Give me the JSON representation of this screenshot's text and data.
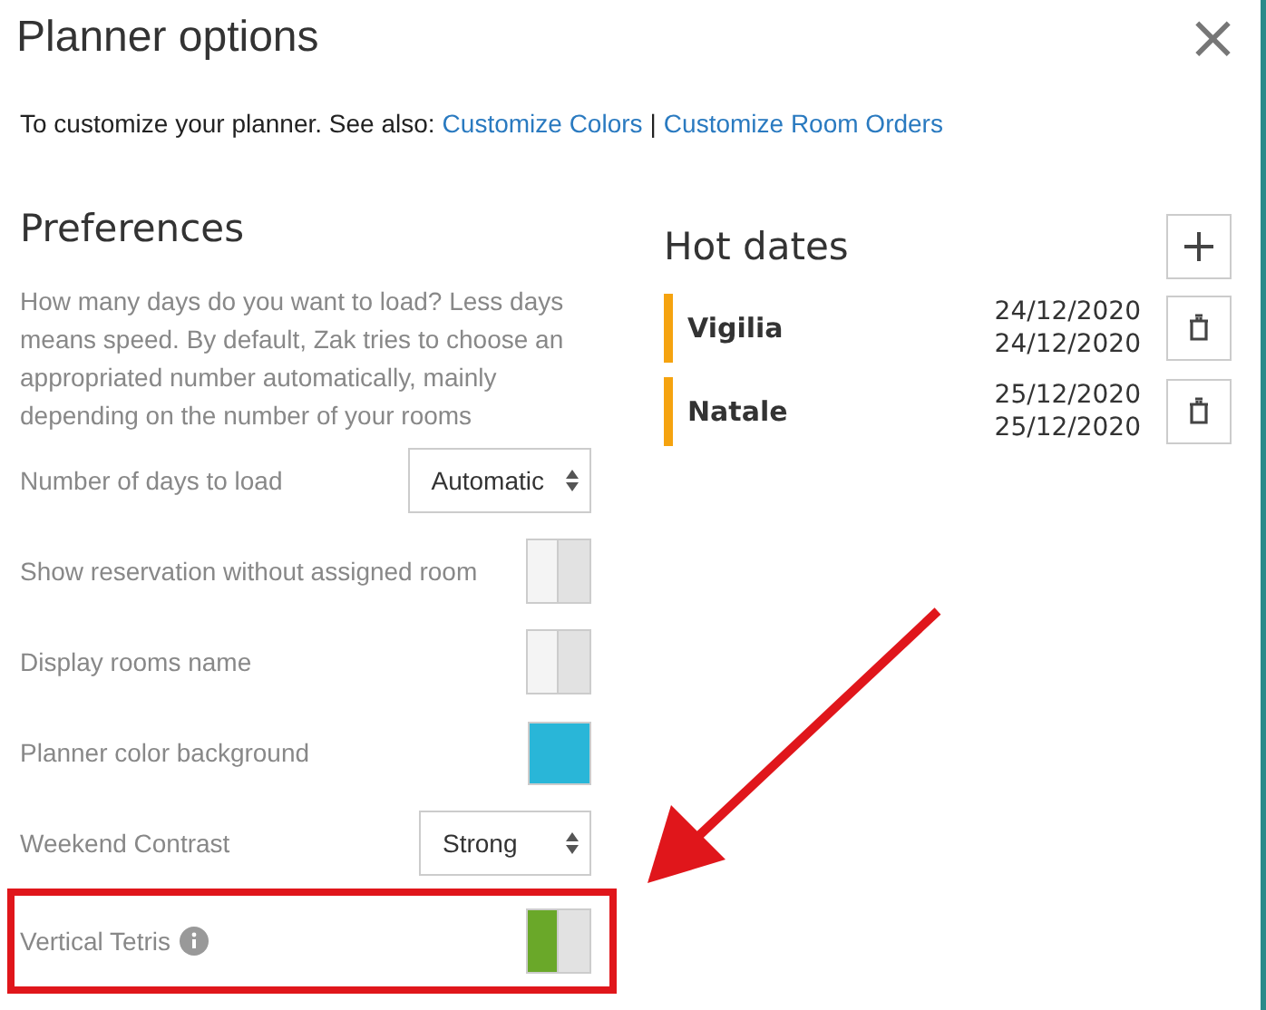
{
  "dialog": {
    "title": "Planner options",
    "close": "×"
  },
  "intro": {
    "text": "To customize your planner. See also:",
    "links": [
      {
        "label": "Customize Colors"
      },
      {
        "label": "Customize Room Orders"
      }
    ],
    "separator": "|"
  },
  "preferences": {
    "heading": "Preferences",
    "description": "How many days do you want to load? Less days means speed. By default, Zak tries to choose an appropriated number automatically, mainly depending on the number of your rooms",
    "settings": [
      {
        "kind": "select",
        "label": "Number of days to load",
        "value": "Automatic"
      },
      {
        "kind": "toggle",
        "label": "Show reservation without assigned room",
        "on": false
      },
      {
        "kind": "toggle",
        "label": "Display rooms name",
        "on": false
      },
      {
        "kind": "color",
        "label": "Planner color background",
        "color": "#29b6d8"
      },
      {
        "kind": "select",
        "label": "Weekend Contrast",
        "value": "Strong"
      },
      {
        "kind": "toggle",
        "label": "Vertical Tetris",
        "on": true,
        "info": true,
        "highlighted": true
      }
    ]
  },
  "hot_dates": {
    "heading": "Hot dates",
    "items": [
      {
        "name": "Vigilia",
        "start": "24/12/2020",
        "end": "24/12/2020",
        "color": "#f5a30f"
      },
      {
        "name": "Natale",
        "start": "25/12/2020",
        "end": "25/12/2020",
        "color": "#f5a30f"
      }
    ]
  }
}
